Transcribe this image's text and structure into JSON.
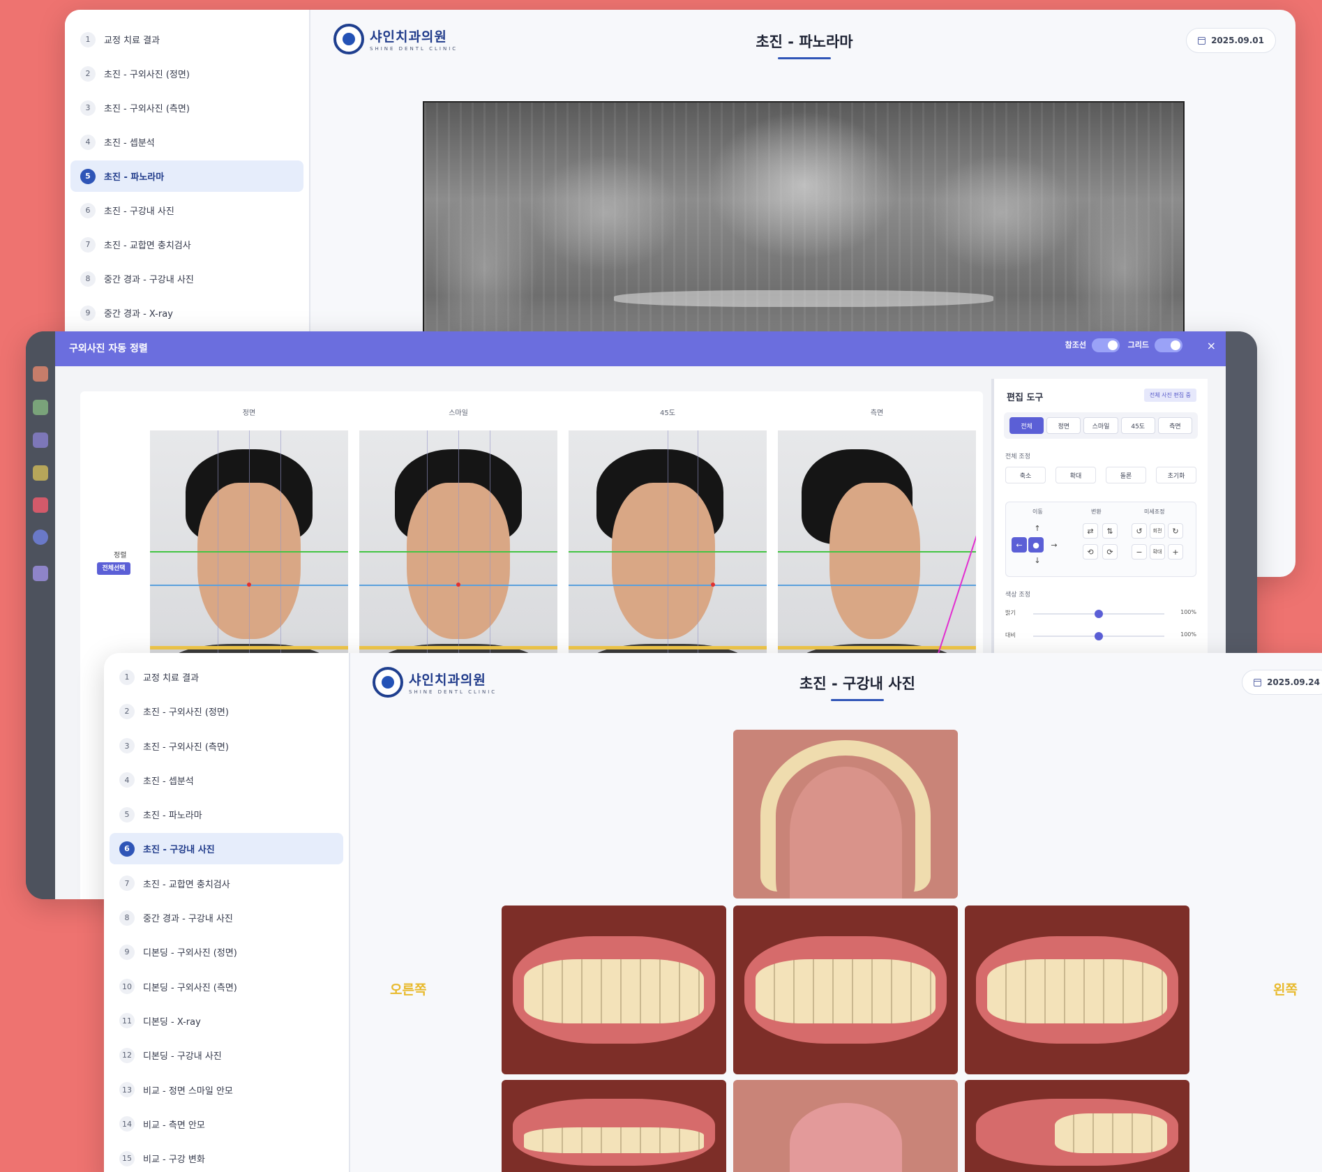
{
  "panorama_window": {
    "sidebar": [
      {
        "num": "1",
        "label": "교정 치료 결과"
      },
      {
        "num": "2",
        "label": "초진 - 구외사진 (정면)"
      },
      {
        "num": "3",
        "label": "초진 - 구외사진 (측면)"
      },
      {
        "num": "4",
        "label": "초진 - 셉분석"
      },
      {
        "num": "5",
        "label": "초진 - 파노라마",
        "active": true
      },
      {
        "num": "6",
        "label": "초진 - 구강내 사진"
      },
      {
        "num": "7",
        "label": "초진 - 교합면 충치검사"
      },
      {
        "num": "8",
        "label": "중간 경과 - 구강내 사진"
      },
      {
        "num": "9",
        "label": "중간 경과 - X-ray"
      }
    ],
    "logo": {
      "name": "샤인치과의원",
      "sub": "SHINE DENTL CLINIC"
    },
    "title": "초진 - 파노라마",
    "date": "2025.09.01"
  },
  "alignment_modal": {
    "title": "구외사진 자동 정렬",
    "toggle_reference": "참조선",
    "toggle_grid": "그리드",
    "close": "×",
    "views": [
      "정면",
      "스마일",
      "45도",
      "측면"
    ],
    "align_label": "정렬",
    "select_all": "전체선택",
    "tools": {
      "title": "편집 도구",
      "badge": "전체 사진 편집 중",
      "tabs": [
        "전체",
        "정면",
        "스마일",
        "45도",
        "측면"
      ],
      "overall_label": "전체 조정",
      "overall_buttons": [
        "축소",
        "확대",
        "돌론",
        "초기화"
      ],
      "move_label": "이동",
      "transform_label": "변환",
      "fine_label": "미세조정",
      "fine_buttons": [
        "회전",
        "확대"
      ],
      "color_label": "색상 조정",
      "sliders": [
        {
          "label": "밝기",
          "value": "100%",
          "level": 0.5
        },
        {
          "label": "대비",
          "value": "100%",
          "level": 0.5
        }
      ]
    },
    "colors": {
      "header": "#6b6ede",
      "accent": "#5b5fd6"
    }
  },
  "intraoral_window": {
    "sidebar": [
      {
        "num": "1",
        "label": "교정 치료 결과"
      },
      {
        "num": "2",
        "label": "초진 - 구외사진 (정면)"
      },
      {
        "num": "3",
        "label": "초진 - 구외사진 (측면)"
      },
      {
        "num": "4",
        "label": "초진 - 셉분석"
      },
      {
        "num": "5",
        "label": "초진 - 파노라마"
      },
      {
        "num": "6",
        "label": "초진 - 구강내 사진",
        "active": true
      },
      {
        "num": "7",
        "label": "초진 - 교합면 충치검사"
      },
      {
        "num": "8",
        "label": "중간 경과 - 구강내 사진"
      },
      {
        "num": "9",
        "label": "디본딩 - 구외사진 (정면)"
      },
      {
        "num": "10",
        "label": "디본딩 - 구외사진 (측면)"
      },
      {
        "num": "11",
        "label": "디본딩 - X-ray"
      },
      {
        "num": "12",
        "label": "디본딩 - 구강내 사진"
      },
      {
        "num": "13",
        "label": "비교 - 정면 스마일 안모"
      },
      {
        "num": "14",
        "label": "비교 - 측면 안모"
      },
      {
        "num": "15",
        "label": "비교 - 구강 변화"
      }
    ],
    "logo": {
      "name": "샤인치과의원",
      "sub": "SHINE DENTL CLINIC"
    },
    "title": "초진 - 구강내 사진",
    "date": "2025.09.24",
    "right_label": "오른쪽",
    "left_label": "왼쪽"
  }
}
